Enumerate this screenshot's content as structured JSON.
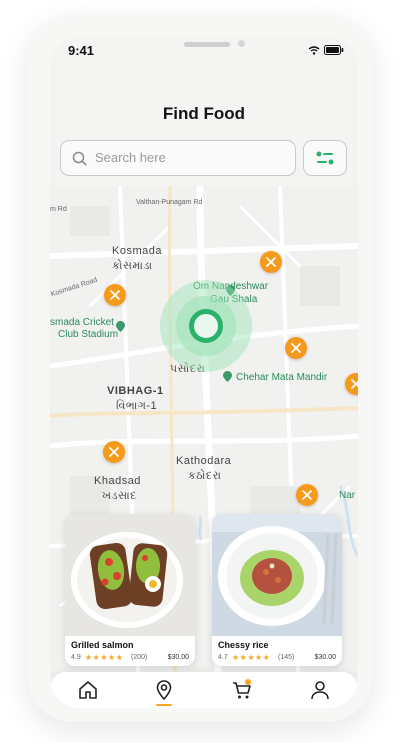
{
  "status_bar": {
    "time": "9:41"
  },
  "header": {
    "title": "Find Food"
  },
  "search": {
    "placeholder": "Search here"
  },
  "map": {
    "labels": {
      "road_top": "Valthan-Punagam Rd",
      "road_left": "m Rd",
      "area_kosmada": "Kosmada",
      "area_kosmada_gu": "કોસમાડા",
      "kosmada_road": "Kosmada Road",
      "om_nandeshwar": "Om Nandeshwar",
      "gau_shala": "Gau Shala",
      "cricket_line1": "smada Cricket",
      "cricket_line2": "Club Stadium",
      "pasodara_gu": "પસોદરા",
      "chehar_mata": "Chehar Mata Mandir",
      "vibhag": "VIBHAG-1",
      "vibhag_gu": "વિભાગ-1",
      "kathodara": "Kathodara",
      "kathodara_gu": "કઠોદરા",
      "khadsad": "Khadsad",
      "khadsad_gu": "ખડસાદ",
      "right_edge": "Nar"
    }
  },
  "food_cards": [
    {
      "name": "Grilled salmon",
      "rating": "4.9",
      "stars": "★★★★★",
      "reviews": "(200)",
      "price": "$30.00"
    },
    {
      "name": "Chessy rice",
      "rating": "4.7",
      "stars": "★★★★★",
      "reviews": "(145)",
      "price": "$30.00"
    }
  ],
  "nav": {
    "cart_badge": ""
  },
  "colors": {
    "accent": "#f59a1b",
    "green": "#2bb26a"
  }
}
